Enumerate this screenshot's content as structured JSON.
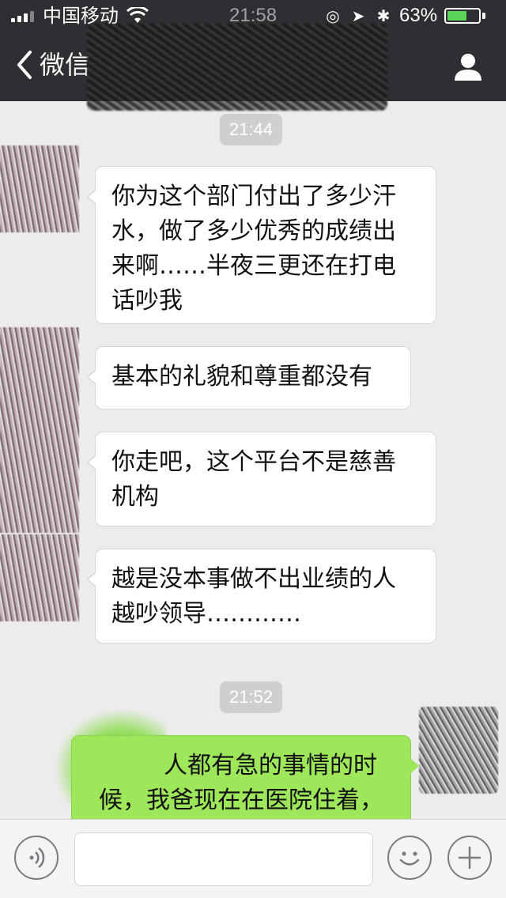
{
  "status_bar": {
    "carrier": "中国移动",
    "time": "21:58",
    "battery_percent": "63%",
    "battery_level": 0.63,
    "icons": [
      "signal-icon",
      "wifi-icon",
      "lock-rotation-icon",
      "location-icon",
      "bluetooth-icon",
      "battery-icon"
    ]
  },
  "nav": {
    "back_label": "微信",
    "back_icon": "chevron-left-icon",
    "profile_icon": "person-icon"
  },
  "messages": [
    {
      "type": "time",
      "text": "21:44"
    },
    {
      "type": "incoming",
      "lines": [
        "你为这个部门付出了多少汗",
        "水，做了多少优秀的成绩出",
        "来啊……半夜三更还在打电",
        "话吵我"
      ]
    },
    {
      "type": "incoming",
      "lines": [
        "基本的礼貌和尊重都没有"
      ]
    },
    {
      "type": "incoming",
      "lines": [
        "你走吧，这个平台不是慈善",
        "机构"
      ]
    },
    {
      "type": "incoming",
      "lines": [
        "越是没本事做不出业绩的人",
        "越吵领导…………"
      ]
    },
    {
      "type": "time",
      "text": "21:52"
    },
    {
      "type": "outgoing",
      "lines": [
        "人都有急的事情的时",
        "候，我爸现在在医院住着，"
      ]
    }
  ],
  "colors": {
    "header": "#2f2f33",
    "chat_background": "#ececec",
    "incoming_bubble": "#ffffff",
    "outgoing_bubble": "#9ee65a",
    "battery_fill": "#5ad45a"
  },
  "input_bar": {
    "voice_icon": "voice-icon",
    "emoji_icon": "emoji-icon",
    "plus_icon": "plus-icon",
    "text_value": ""
  }
}
